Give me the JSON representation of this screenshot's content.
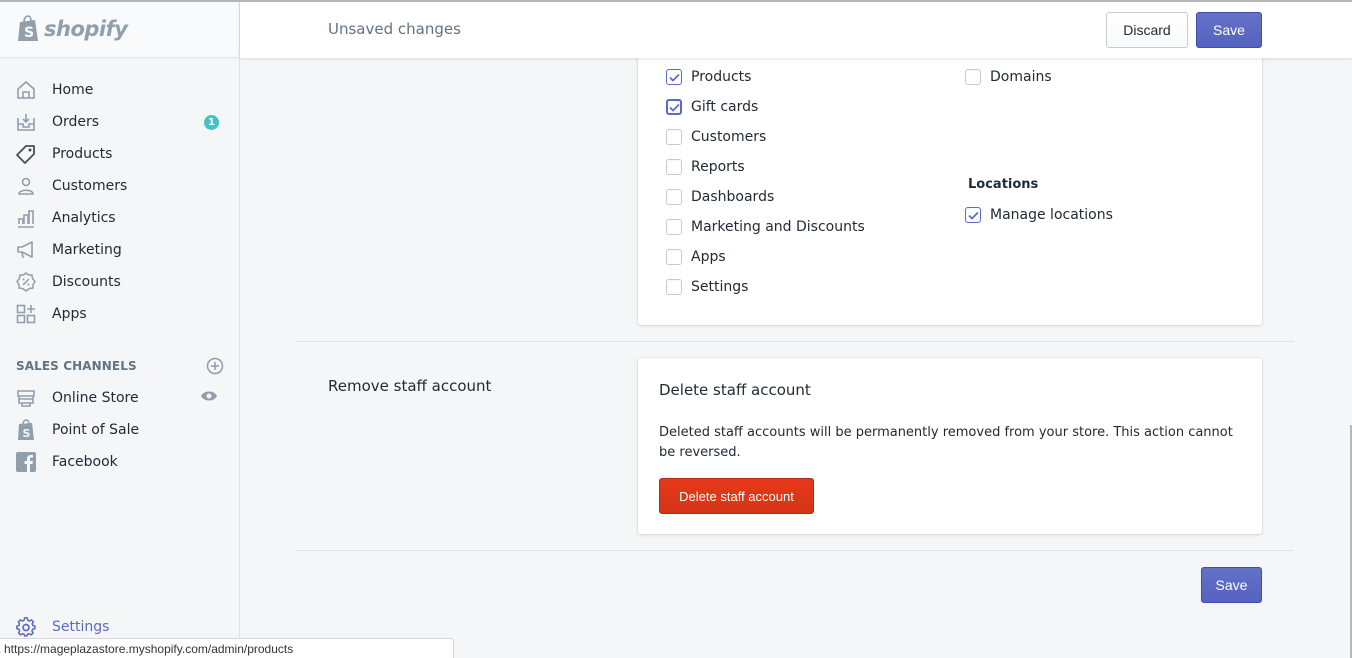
{
  "brand": {
    "name": "shopify"
  },
  "header": {
    "title": "Unsaved changes",
    "discard_label": "Discard",
    "save_label": "Save"
  },
  "sidebar": {
    "items": [
      {
        "label": "Home",
        "icon": "home-icon"
      },
      {
        "label": "Orders",
        "icon": "orders-icon",
        "badge": "1"
      },
      {
        "label": "Products",
        "icon": "tag-icon"
      },
      {
        "label": "Customers",
        "icon": "customer-icon"
      },
      {
        "label": "Analytics",
        "icon": "analytics-icon"
      },
      {
        "label": "Marketing",
        "icon": "megaphone-icon"
      },
      {
        "label": "Discounts",
        "icon": "discount-icon"
      },
      {
        "label": "Apps",
        "icon": "apps-icon"
      }
    ],
    "sales_channels": {
      "title": "SALES CHANNELS",
      "items": [
        {
          "label": "Online Store",
          "icon": "store-icon"
        },
        {
          "label": "Point of Sale",
          "icon": "shopify-bag-icon"
        },
        {
          "label": "Facebook",
          "icon": "facebook-icon"
        }
      ]
    },
    "settings_label": "Settings"
  },
  "permissions": {
    "left_column": [
      {
        "label": "Products",
        "checked": true
      },
      {
        "label": "Gift cards",
        "checked": true
      },
      {
        "label": "Customers",
        "checked": false
      },
      {
        "label": "Reports",
        "checked": false
      },
      {
        "label": "Dashboards",
        "checked": false
      },
      {
        "label": "Marketing and Discounts",
        "checked": false
      },
      {
        "label": "Apps",
        "checked": false
      },
      {
        "label": "Settings",
        "checked": false
      }
    ],
    "right_column": [
      {
        "label": "Domains",
        "checked": false
      }
    ],
    "locations": {
      "title": "Locations",
      "items": [
        {
          "label": "Manage locations",
          "checked": true
        }
      ]
    }
  },
  "remove_section": {
    "label": "Remove staff account",
    "card_title": "Delete staff account",
    "description": "Deleted staff accounts will be permanently removed from your store. This action cannot be reversed.",
    "delete_button": "Delete staff account"
  },
  "footer": {
    "save_label": "Save"
  },
  "status_bar": {
    "url": "https://mageplazastore.myshopify.com/admin/products"
  },
  "colors": {
    "primary": "#5c6ac4",
    "destructive": "#de3618",
    "badge": "#47c1bf",
    "icon_gray": "#919eab"
  }
}
